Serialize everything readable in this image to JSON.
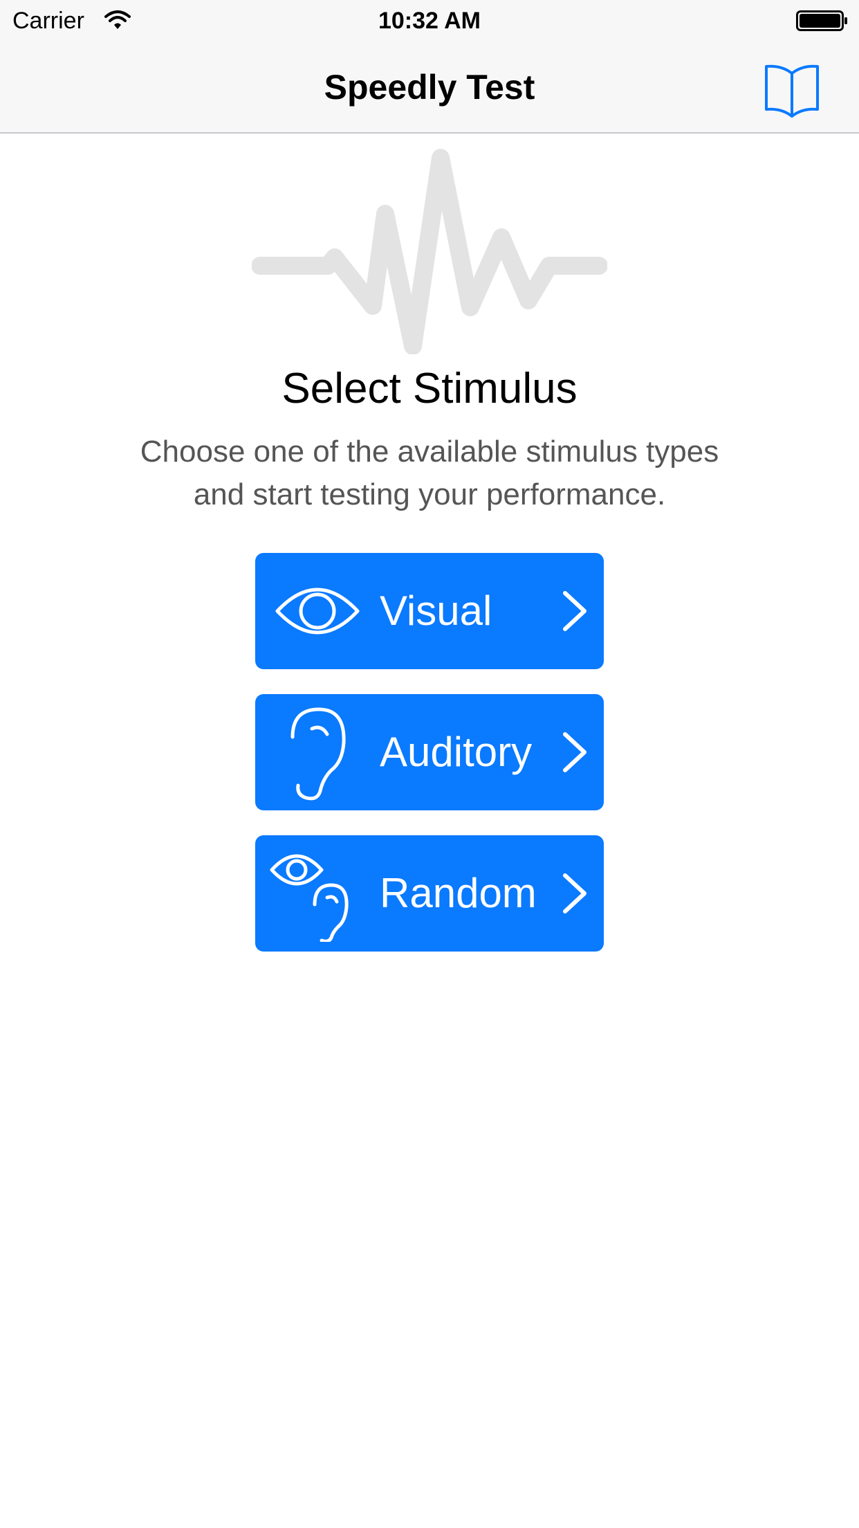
{
  "status_bar": {
    "carrier": "Carrier",
    "time": "10:32 AM"
  },
  "nav": {
    "title": "Speedly Test",
    "right_icon": "book-icon"
  },
  "main": {
    "header_icon": "waveform-icon",
    "heading": "Select Stimulus",
    "subtitle_line1": "Choose one of the available stimulus types",
    "subtitle_line2": "and start testing your performance."
  },
  "buttons": [
    {
      "label": "Visual",
      "icon": "eye-icon"
    },
    {
      "label": "Auditory",
      "icon": "ear-icon"
    },
    {
      "label": "Random",
      "icon": "eye-and-ear-icon"
    }
  ],
  "colors": {
    "accent": "#0a7aff",
    "bar_background": "#f7f7f7",
    "waveform": "#e3e3e3",
    "text": "#000000",
    "subtitle_text": "#555555"
  }
}
